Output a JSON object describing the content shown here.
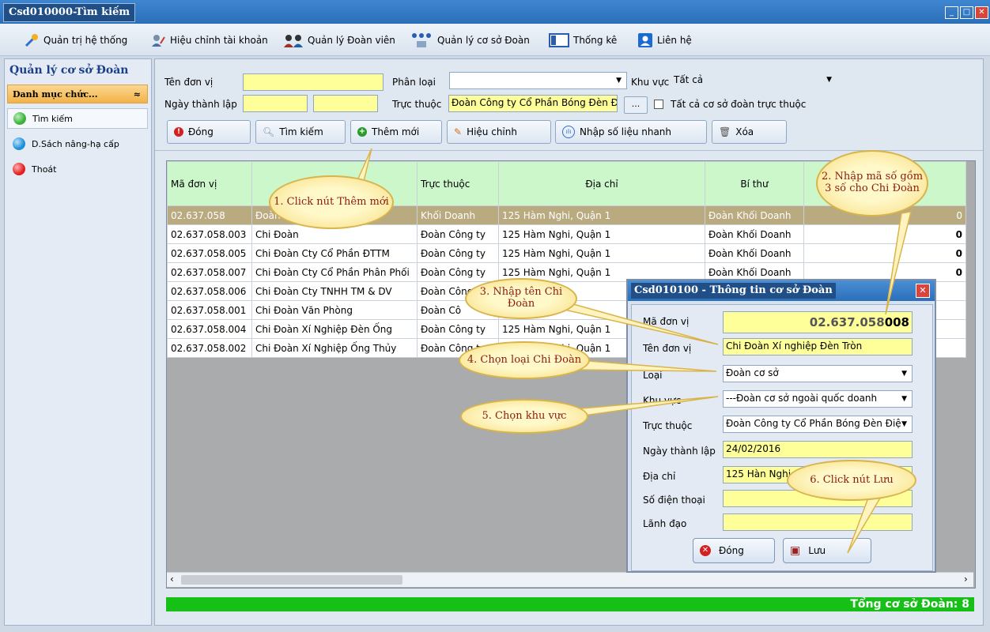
{
  "window": {
    "title": "Csd010000-Tìm kiếm"
  },
  "menu": [
    {
      "label": "Quản trị hệ thống",
      "icon": "tools-icon"
    },
    {
      "label": "Hiệu chỉnh tài khoản",
      "icon": "user-edit-icon"
    },
    {
      "label": "Quản lý Đoàn viên",
      "icon": "members-icon"
    },
    {
      "label": "Quản lý cơ sở Đoàn",
      "icon": "org-network-icon"
    },
    {
      "label": "Thống kê",
      "icon": "stats-icon"
    },
    {
      "label": "Liên hệ",
      "icon": "contact-icon"
    }
  ],
  "left": {
    "title": "Quản lý cơ sở Đoàn",
    "section": "Danh mục chức...",
    "items": [
      {
        "label": "Tìm kiếm",
        "color": "#3bb13b"
      },
      {
        "label": "D.Sách nâng-hạ cấp",
        "color": "#1e8fd6"
      },
      {
        "label": "Thoát",
        "color": "#e02020"
      }
    ]
  },
  "filter": {
    "ten_don_vi_label": "Tên đơn vị",
    "phan_loai_label": "Phân loại",
    "khu_vuc_label": "Khu vực",
    "khu_vuc_value": "Tất cả",
    "ngay_thanh_lap_label": "Ngày thành lập",
    "truc_thuoc_label": "Trực thuộc",
    "truc_thuoc_value": "Đoàn Công ty Cổ Phần Bóng Đèn Đ",
    "browse": "...",
    "all_label": "Tất cả cơ sở đoàn trực thuộc"
  },
  "toolbar": {
    "close": "Đóng",
    "search": "Tìm kiếm",
    "add": "Thêm mới",
    "edit": "Hiệu chỉnh",
    "quick": "Nhập số liệu nhanh",
    "delete": "Xóa"
  },
  "grid": {
    "columns": [
      "Mã đơn vị",
      "",
      "Trực thuộc",
      "Địa chỉ",
      "Bí thư",
      ""
    ],
    "rows": [
      {
        "code": "02.637.058",
        "name": "Đoàn",
        "parent": "Khối Doanh",
        "addr": "125 Hàm Nghi, Quận 1",
        "sec": "Đoàn Khối Doanh",
        "num": "0",
        "selected": true
      },
      {
        "code": "02.637.058.003",
        "name": "Chi Đoàn",
        "parent": "Đoàn Công ty",
        "addr": "125 Hàm Nghi, Quận 1",
        "sec": "Đoàn Khối Doanh",
        "num": "0"
      },
      {
        "code": "02.637.058.005",
        "name": "Chi Đoàn Cty Cổ Phần ĐTTM",
        "parent": "Đoàn Công ty",
        "addr": "125 Hàm Nghi, Quận 1",
        "sec": "Đoàn Khối Doanh",
        "num": "0"
      },
      {
        "code": "02.637.058.007",
        "name": "Chi Đoàn Cty Cổ Phần Phân Phối",
        "parent": "Đoàn Công ty",
        "addr": "125 Hàm Nghi, Quận 1",
        "sec": "Đoàn Khối Doanh",
        "num": "0"
      },
      {
        "code": "02.637.058.006",
        "name": "Chi Đoàn Cty TNHH TM & DV",
        "parent": "Đoàn Công",
        "addr": "Quận 1",
        "sec": "",
        "num": ""
      },
      {
        "code": "02.637.058.001",
        "name": "Chi Đoàn Văn Phòng",
        "parent": "Đoàn Cô",
        "addr": "Quận 1",
        "sec": "",
        "num": ""
      },
      {
        "code": "02.637.058.004",
        "name": "Chi Đoàn Xí Nghiệp Đèn Ống",
        "parent": "Đoàn Công ty",
        "addr": "125 Hàm Nghi, Quận 1",
        "sec": "",
        "num": ""
      },
      {
        "code": "02.637.058.002",
        "name": "Chi Đoàn Xí Nghiệp Ống Thủy",
        "parent": "Đoàn Công ty",
        "addr": "125 Hàm Nghi, Quận 1",
        "sec": "",
        "num": ""
      }
    ],
    "total": "Tổng cơ sở Đoàn: 8"
  },
  "dialog": {
    "title": "Csd010100 - Thông tin cơ sở Đoàn",
    "labels": [
      "Mã đơn vị",
      "Tên đơn vị",
      "Loại",
      "Khu vực",
      "Trực thuộc",
      "Ngày thành lập",
      "Địa chỉ",
      "Số điện thoại",
      "Lãnh đạo"
    ],
    "ma_prefix": "02.637.058",
    "ma_suffix": "008",
    "ten": "Chi Đoàn Xí nghiệp Đèn Tròn",
    "loai": "Đoàn cơ sở",
    "khu_vuc": "---Đoàn cơ sở ngoài quốc doanh",
    "truc_thuoc": "Đoàn Công ty Cổ Phần Bóng Đèn Điệ",
    "ngay": "24/02/2016",
    "dia_chi": "125 Hàn Nghi, Q",
    "so_dt": "",
    "lanh_dao": "",
    "close": "Đóng",
    "save": "Lưu"
  },
  "callouts": [
    "1. Click nút Thêm mới",
    "2. Nhập mã số gồm 3 số cho Chi Đoàn",
    "3. Nhập tên Chi Đoàn",
    "4. Chọn loại Chi Đoàn",
    "5. Chọn khu vực",
    "6. Click nút Lưu"
  ]
}
